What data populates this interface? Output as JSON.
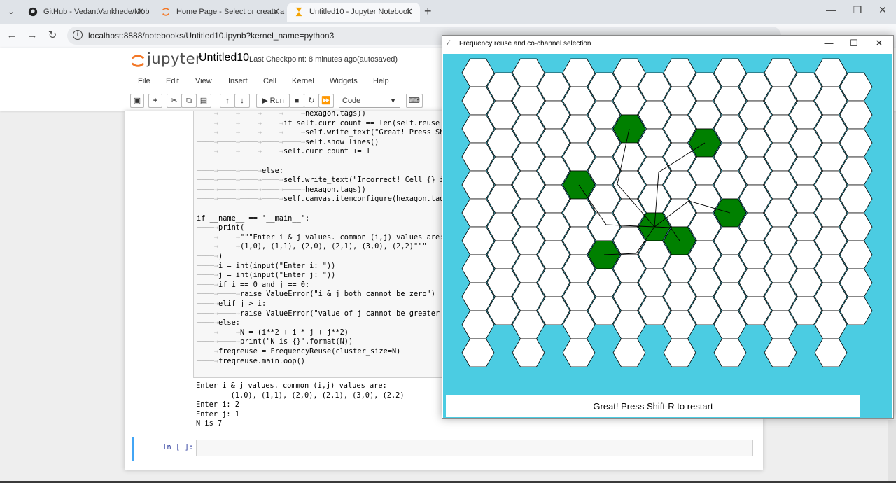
{
  "browser": {
    "tabs": [
      {
        "label": "GitHub - VedantVankhede/Mob",
        "icon": "github-icon"
      },
      {
        "label": "Home Page - Select or create a",
        "icon": "jupyter-tab-icon"
      },
      {
        "label": "Untitled10 - Jupyter Notebook",
        "icon": "hourglass-icon"
      }
    ],
    "url": "localhost:8888/notebooks/Untitled10.ipynb?kernel_name=python3"
  },
  "jupyter": {
    "logo_text": "jupyter",
    "notebook_name": "Untitled10",
    "checkpoint": "Last Checkpoint: 8 minutes ago",
    "autosaved": "(autosaved)",
    "menu": [
      "File",
      "Edit",
      "View",
      "Insert",
      "Cell",
      "Kernel",
      "Widgets",
      "Help"
    ],
    "run_label": "Run",
    "cell_type": "Code",
    "prompt": "In [ ]:"
  },
  "code_lines": [
    "hexagon.tags))",
    "if self.curr_count == len(self.reuse_list",
    "self.write_text(\"Great! Press Shift-R",
    "self.show_lines()",
    "self.curr_count += 1",
    "",
    "else:",
    "self.write_text(\"Incorrect! Cell {} is no",
    "hexagon.tags))",
    "self.canvas.itemconfigure(hexagon.tags, f",
    "",
    "if __name__ == '__main__':",
    "print(",
    "\"\"\"Enter i & j values. common (i,j) values are:",
    "(1,0), (1,1), (2,0), (2,1), (3,0), (2,2)\"\"\"",
    ")",
    "i = int(input(\"Enter i: \"))",
    "j = int(input(\"Enter j: \"))",
    "if i == 0 and j == 0:",
    "raise ValueError(\"i & j both cannot be zero\")",
    "elif j > i:",
    "raise ValueError(\"value of j cannot be greater th",
    "else:",
    "N = (i**2 + i * j + j**2)",
    "print(\"N is {}\".format(N))",
    "freqreuse = FrequencyReuse(cluster_size=N)",
    "freqreuse.mainloop()"
  ],
  "output_lines": [
    "Enter i & j values. common (i,j) values are:",
    "        (1,0), (1,1), (2,0), (2,1), (3,0), (2,2)",
    "Enter i: 2",
    "Enter j: 1",
    "N is 7"
  ],
  "tk_window": {
    "title": "Frequency reuse and co-channel selection",
    "message": "Great! Press Shift-R to restart",
    "canvas_color": "#4bcce2",
    "cell_color": "#ffffff",
    "selected_color": "#008000",
    "grid_columns": 16,
    "grid_rows": 10,
    "center_cell": [
      7,
      5
    ],
    "selected_cells": [
      [
        6,
        2
      ],
      [
        9,
        2
      ],
      [
        4,
        4
      ],
      [
        10,
        5
      ],
      [
        5,
        6
      ],
      [
        8,
        6
      ]
    ]
  },
  "colors": {
    "tabbar": "#dfe3e8",
    "cell_border": "#42a5f5"
  }
}
